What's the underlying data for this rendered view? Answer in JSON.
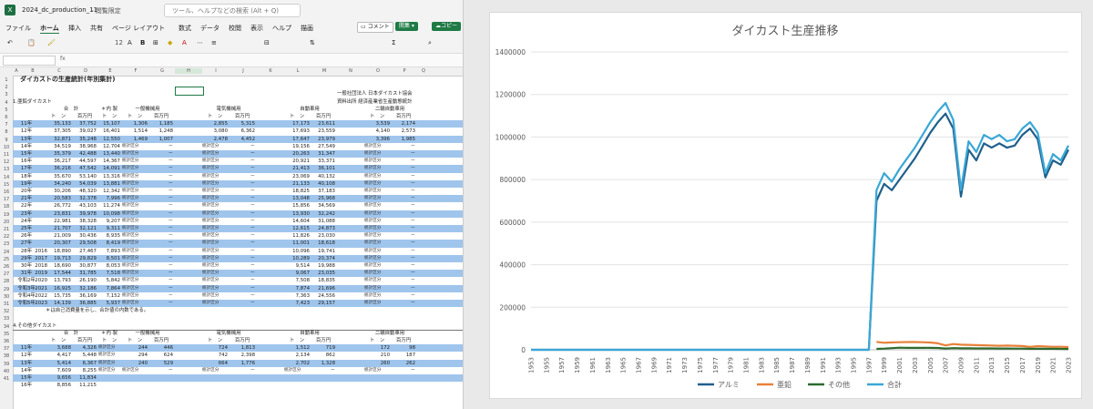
{
  "app": {
    "file_name": "2024_dc_production_11",
    "sensitivity": "閲覧限定",
    "search_placeholder": "ツール、ヘルプなどの検索 (Alt + Q)",
    "comment_button": "コメント",
    "edit_button": "開集",
    "copy_button": "コピー",
    "font_size": "12",
    "cell_ref": ""
  },
  "menu": [
    "ファイル",
    "ホーム",
    "挿入",
    "共有",
    "ページ レイアウト",
    "数式",
    "データ",
    "校閲",
    "表示",
    "ヘルプ",
    "描画"
  ],
  "columns": [
    "A",
    "B",
    "C",
    "D",
    "E",
    "F",
    "G",
    "H",
    "I",
    "J",
    "K",
    "L",
    "M",
    "N",
    "O",
    "P",
    "Q"
  ],
  "rows": [
    "1",
    "2",
    "3",
    "4",
    "5",
    "6",
    "7",
    "8",
    "9",
    "10",
    "11",
    "12",
    "13",
    "14",
    "15",
    "16",
    "17",
    "18",
    "19",
    "20",
    "21",
    "22",
    "23",
    "24",
    "25",
    "26",
    "27",
    "28",
    "29",
    "30",
    "31",
    "32",
    "33",
    "34",
    "35",
    "36",
    "37",
    "38",
    "39",
    "40",
    "41"
  ],
  "sheet": {
    "title": "ダイカストの生産統計(年別集計)",
    "org": "一般社団法人 日本ダイカスト協会",
    "source": "資料出所 経済産業省生産動態統計",
    "section1": "1.亜鉛ダイカスト",
    "section2": "4.その他ダイカスト",
    "note": "＊は自己消費量を示し、合計値の内数である。",
    "headers": {
      "total": "合　計",
      "naisei": "＊内 製",
      "ippan": "一般機械用",
      "denki": "電気機械用",
      "jidosha": "自動車用",
      "nirin": "二輪自動車用",
      "ton": "ト　ン",
      "man": "百万円"
    },
    "stat_label": "統計区分",
    "dash": "－",
    "zn_rows": [
      {
        "label": "11年",
        "y": "",
        "t": "35,133",
        "m": "37,752",
        "n": "15,107",
        "gt": "1,306",
        "gm": "1,185",
        "et": "2,855",
        "em": "5,315",
        "jt": "17,173",
        "jm": "23,611",
        "nt": "3,539",
        "nm": "2,174",
        "blue": true
      },
      {
        "label": "12年",
        "y": "",
        "t": "37,305",
        "m": "39,027",
        "n": "16,401",
        "gt": "1,514",
        "gm": "1,248",
        "et": "3,080",
        "em": "6,362",
        "jt": "17,693",
        "jm": "23,559",
        "nt": "4,140",
        "nm": "2,573",
        "blue": false
      },
      {
        "label": "13年",
        "y": "",
        "t": "32,871",
        "m": "35,248",
        "n": "12,550",
        "gt": "1,469",
        "gm": "1,007",
        "et": "2,478",
        "em": "4,452",
        "jt": "17,647",
        "jm": "23,979",
        "nt": "3,396",
        "nm": "1,985",
        "blue": true
      },
      {
        "label": "14年",
        "y": "",
        "t": "34,519",
        "m": "38,968",
        "n": "12,704",
        "gt": "統計区分",
        "gm": "－",
        "et": "統計区分",
        "em": "－",
        "jt": "19,156",
        "jm": "27,549",
        "nt": "統計区分",
        "nm": "－",
        "blue": false
      },
      {
        "label": "15年",
        "y": "",
        "t": "35,379",
        "m": "42,488",
        "n": "13,440",
        "gt": "統計区分",
        "gm": "－",
        "et": "統計区分",
        "em": "－",
        "jt": "20,263",
        "jm": "31,347",
        "nt": "統計区分",
        "nm": "－",
        "blue": true
      },
      {
        "label": "16年",
        "y": "",
        "t": "36,217",
        "m": "44,597",
        "n": "14,367",
        "gt": "統計区分",
        "gm": "－",
        "et": "統計区分",
        "em": "－",
        "jt": "20,921",
        "jm": "33,371",
        "nt": "統計区分",
        "nm": "－",
        "blue": false
      },
      {
        "label": "17年",
        "y": "",
        "t": "36,216",
        "m": "47,542",
        "n": "14,091",
        "gt": "統計区分",
        "gm": "－",
        "et": "統計区分",
        "em": "－",
        "jt": "21,413",
        "jm": "36,101",
        "nt": "統計区分",
        "nm": "－",
        "blue": true
      },
      {
        "label": "18年",
        "y": "",
        "t": "35,670",
        "m": "53,140",
        "n": "13,316",
        "gt": "統計区分",
        "gm": "－",
        "et": "統計区分",
        "em": "－",
        "jt": "23,069",
        "jm": "40,132",
        "nt": "統計区分",
        "nm": "－",
        "blue": false
      },
      {
        "label": "19年",
        "y": "",
        "t": "34,240",
        "m": "54,039",
        "n": "13,881",
        "gt": "統計区分",
        "gm": "－",
        "et": "統計区分",
        "em": "－",
        "jt": "21,133",
        "jm": "40,108",
        "nt": "統計区分",
        "nm": "－",
        "blue": true
      },
      {
        "label": "20年",
        "y": "",
        "t": "30,206",
        "m": "48,320",
        "n": "12,342",
        "gt": "統計区分",
        "gm": "－",
        "et": "統計区分",
        "em": "－",
        "jt": "18,825",
        "jm": "37,183",
        "nt": "統計区分",
        "nm": "－",
        "blue": false
      },
      {
        "label": "21年",
        "y": "",
        "t": "20,583",
        "m": "32,378",
        "n": "7,996",
        "gt": "統計区分",
        "gm": "－",
        "et": "統計区分",
        "em": "－",
        "jt": "13,048",
        "jm": "25,968",
        "nt": "統計区分",
        "nm": "－",
        "blue": true
      },
      {
        "label": "22年",
        "y": "",
        "t": "26,772",
        "m": "43,103",
        "n": "11,274",
        "gt": "統計区分",
        "gm": "－",
        "et": "統計区分",
        "em": "－",
        "jt": "15,856",
        "jm": "34,569",
        "nt": "統計区分",
        "nm": "－",
        "blue": false
      },
      {
        "label": "23年",
        "y": "",
        "t": "23,831",
        "m": "39,978",
        "n": "10,098",
        "gt": "統計区分",
        "gm": "－",
        "et": "統計区分",
        "em": "－",
        "jt": "13,930",
        "jm": "32,242",
        "nt": "統計区分",
        "nm": "－",
        "blue": true
      },
      {
        "label": "24年",
        "y": "",
        "t": "22,981",
        "m": "38,328",
        "n": "9,207",
        "gt": "統計区分",
        "gm": "－",
        "et": "統計区分",
        "em": "－",
        "jt": "14,604",
        "jm": "31,088",
        "nt": "統計区分",
        "nm": "－",
        "blue": false
      },
      {
        "label": "25年",
        "y": "",
        "t": "21,707",
        "m": "32,121",
        "n": "9,311",
        "gt": "統計区分",
        "gm": "－",
        "et": "統計区分",
        "em": "－",
        "jt": "12,615",
        "jm": "24,873",
        "nt": "統計区分",
        "nm": "－",
        "blue": true
      },
      {
        "label": "26年",
        "y": "",
        "t": "21,009",
        "m": "30,436",
        "n": "8,935",
        "gt": "統計区分",
        "gm": "－",
        "et": "統計区分",
        "em": "－",
        "jt": "11,826",
        "jm": "23,030",
        "nt": "統計区分",
        "nm": "－",
        "blue": false
      },
      {
        "label": "27年",
        "y": "",
        "t": "20,307",
        "m": "29,508",
        "n": "8,419",
        "gt": "統計区分",
        "gm": "－",
        "et": "統計区分",
        "em": "－",
        "jt": "11,001",
        "jm": "18,618",
        "nt": "統計区分",
        "nm": "－",
        "blue": true
      },
      {
        "label": "28年",
        "y": "2016",
        "t": "18,890",
        "m": "27,467",
        "n": "7,893",
        "gt": "統計区分",
        "gm": "－",
        "et": "統計区分",
        "em": "－",
        "jt": "10,096",
        "jm": "19,741",
        "nt": "統計区分",
        "nm": "－",
        "blue": false
      },
      {
        "label": "29年",
        "y": "2017",
        "t": "19,713",
        "m": "29,829",
        "n": "8,501",
        "gt": "統計区分",
        "gm": "－",
        "et": "統計区分",
        "em": "－",
        "jt": "10,289",
        "jm": "20,374",
        "nt": "統計区分",
        "nm": "－",
        "blue": true
      },
      {
        "label": "30年",
        "y": "2018",
        "t": "18,690",
        "m": "30,877",
        "n": "8,053",
        "gt": "統計区分",
        "gm": "－",
        "et": "統計区分",
        "em": "－",
        "jt": "9,514",
        "jm": "19,988",
        "nt": "統計区分",
        "nm": "－",
        "blue": false
      },
      {
        "label": "31年",
        "y": "2019",
        "t": "17,544",
        "m": "31,785",
        "n": "7,518",
        "gt": "統計区分",
        "gm": "－",
        "et": "統計区分",
        "em": "－",
        "jt": "9,067",
        "jm": "23,035",
        "nt": "統計区分",
        "nm": "－",
        "blue": true
      },
      {
        "label": "令和2年",
        "y": "2020",
        "t": "13,793",
        "m": "26,190",
        "n": "5,842",
        "gt": "統計区分",
        "gm": "－",
        "et": "統計区分",
        "em": "－",
        "jt": "7,508",
        "jm": "18,835",
        "nt": "統計区分",
        "nm": "－",
        "blue": false
      },
      {
        "label": "令和3年",
        "y": "2021",
        "t": "16,925",
        "m": "32,186",
        "n": "7,864",
        "gt": "統計区分",
        "gm": "－",
        "et": "統計区分",
        "em": "－",
        "jt": "7,874",
        "jm": "21,696",
        "nt": "統計区分",
        "nm": "－",
        "blue": true
      },
      {
        "label": "令和4年",
        "y": "2022",
        "t": "15,735",
        "m": "36,169",
        "n": "7,152",
        "gt": "統計区分",
        "gm": "－",
        "et": "統計区分",
        "em": "－",
        "jt": "7,363",
        "jm": "24,556",
        "nt": "統計区分",
        "nm": "－",
        "blue": false
      },
      {
        "label": "令和5年",
        "y": "2023",
        "t": "14,139",
        "m": "36,885",
        "n": "5,937",
        "gt": "統計区分",
        "gm": "－",
        "et": "統計区分",
        "em": "－",
        "jt": "7,423",
        "jm": "29,157",
        "nt": "統計区分",
        "nm": "－",
        "blue": true
      }
    ],
    "other_rows": [
      {
        "label": "11年",
        "t": "3,688",
        "m": "4,326",
        "n": "統計区分",
        "gt": "244",
        "gm": "446",
        "et": "724",
        "em": "1,813",
        "jt": "1,512",
        "jm": "719",
        "nt": "172",
        "nm": "98",
        "blue": true
      },
      {
        "label": "12年",
        "t": "4,417",
        "m": "5,448",
        "n": "統計区分",
        "gt": "294",
        "gm": "624",
        "et": "742",
        "em": "2,398",
        "jt": "2,134",
        "jm": "862",
        "nt": "210",
        "nm": "187",
        "blue": false
      },
      {
        "label": "13年",
        "t": "5,414",
        "m": "6,367",
        "n": "統計区分",
        "gt": "240",
        "gm": "529",
        "et": "664",
        "em": "1,776",
        "jt": "2,702",
        "jm": "1,328",
        "nt": "260",
        "nm": "262",
        "blue": true
      },
      {
        "label": "14年",
        "t": "7,609",
        "m": "8,255",
        "n": "統計区分",
        "gt": "統計区分",
        "gm": "－",
        "et": "統計区分",
        "em": "－",
        "jt": "統計区分",
        "jm": "－",
        "nt": "統計区分",
        "nm": "－",
        "blue": false
      },
      {
        "label": "15年",
        "t": "9,656",
        "m": "11,834",
        "n": "",
        "gt": "",
        "gm": "",
        "et": "",
        "em": "",
        "jt": "",
        "jm": "",
        "nt": "",
        "nm": "",
        "blue": true
      },
      {
        "label": "16年",
        "t": "8,856",
        "m": "11,215",
        "n": "",
        "gt": "",
        "gm": "",
        "et": "",
        "em": "",
        "jt": "",
        "jm": "",
        "nt": "",
        "nm": "",
        "blue": false
      }
    ]
  },
  "chart_data": {
    "type": "line",
    "title": "ダイカスト生産推移",
    "ylim": [
      0,
      1400000
    ],
    "yticks": [
      "0",
      "200000",
      "400000",
      "600000",
      "800000",
      "1000000",
      "1200000",
      "1400000"
    ],
    "ytick_values": [
      0,
      200000,
      400000,
      600000,
      800000,
      1000000,
      1200000,
      1400000
    ],
    "xlim": [
      1953,
      2023
    ],
    "xticks": [
      "1953",
      "1955",
      "1957",
      "1959",
      "1961",
      "1963",
      "1965",
      "1967",
      "1969",
      "1971",
      "1973",
      "1975",
      "1977",
      "1979",
      "1981",
      "1983",
      "1985",
      "1987",
      "1989",
      "1991",
      "1993",
      "1995",
      "1997",
      "1999",
      "2001",
      "2003",
      "2005",
      "2007",
      "2009",
      "2011",
      "2013",
      "2015",
      "2017",
      "2019",
      "2021",
      "2023"
    ],
    "legend_position": "bottom",
    "grid": true,
    "series": [
      {
        "name": "アルミ",
        "color": "#1f5f8b",
        "x": [
          1953,
          1997,
          1998,
          1999,
          2000,
          2001,
          2002,
          2003,
          2004,
          2005,
          2006,
          2007,
          2008,
          2009,
          2010,
          2011,
          2012,
          2013,
          2014,
          2015,
          2016,
          2017,
          2018,
          2019,
          2020,
          2021,
          2022,
          2023
        ],
        "y": [
          0,
          0,
          700000,
          780000,
          750000,
          800000,
          850000,
          900000,
          960000,
          1020000,
          1070000,
          1110000,
          1040000,
          720000,
          940000,
          890000,
          970000,
          950000,
          970000,
          950000,
          960000,
          1010000,
          1040000,
          990000,
          810000,
          890000,
          870000,
          940000
        ]
      },
      {
        "name": "亜鉛",
        "color": "#e8813a",
        "x": [
          1998,
          1999,
          2000,
          2001,
          2002,
          2003,
          2004,
          2005,
          2006,
          2007,
          2008,
          2009,
          2010,
          2011,
          2012,
          2013,
          2014,
          2015,
          2016,
          2017,
          2018,
          2019,
          2020,
          2021,
          2022,
          2023
        ],
        "y": [
          37305,
          32871,
          34519,
          35379,
          36217,
          36216,
          35670,
          34240,
          30206,
          20583,
          26772,
          23831,
          22981,
          21707,
          21009,
          20307,
          18890,
          19713,
          18690,
          17544,
          13793,
          16925,
          15735,
          14139,
          14000,
          13000
        ]
      },
      {
        "name": "その他",
        "color": "#2e6b2e",
        "x": [
          1998,
          1999,
          2000,
          2001,
          2002,
          2003,
          2004,
          2005,
          2006,
          2007,
          2008,
          2009,
          2010,
          2011,
          2012,
          2013,
          2014,
          2015,
          2016,
          2017,
          2018,
          2019,
          2020,
          2021,
          2022,
          2023
        ],
        "y": [
          4417,
          5414,
          7609,
          9656,
          8856,
          9000,
          9500,
          9000,
          8500,
          6000,
          7500,
          7000,
          6800,
          6600,
          6500,
          6300,
          6000,
          5800,
          5600,
          5400,
          4500,
          5000,
          4800,
          4500,
          4300,
          4000
        ]
      },
      {
        "name": "合計",
        "color": "#3aa7d6",
        "x": [
          1953,
          1997,
          1998,
          1999,
          2000,
          2001,
          2002,
          2003,
          2004,
          2005,
          2006,
          2007,
          2008,
          2009,
          2010,
          2011,
          2012,
          2013,
          2014,
          2015,
          2016,
          2017,
          2018,
          2019,
          2020,
          2021,
          2022,
          2023
        ],
        "y": [
          0,
          0,
          750000,
          830000,
          790000,
          850000,
          900000,
          950000,
          1010000,
          1070000,
          1120000,
          1160000,
          1080000,
          750000,
          980000,
          930000,
          1010000,
          990000,
          1010000,
          980000,
          990000,
          1040000,
          1070000,
          1020000,
          830000,
          920000,
          890000,
          960000
        ]
      }
    ]
  }
}
